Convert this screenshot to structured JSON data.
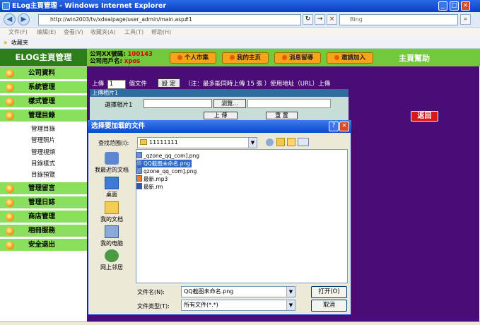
{
  "window": {
    "title": "ELog主頁管理 - Windows Internet Explorer"
  },
  "browser": {
    "url": "http://win2003/tv/xdealpage/user_admin/main.asp#1",
    "search_placeholder": "Bing",
    "menu": [
      "文件(F)",
      "编辑(E)",
      "查看(V)",
      "收藏夹(A)",
      "工具(T)",
      "帮助(H)"
    ],
    "favorites": "收藏夹"
  },
  "header": {
    "logo": "ELOG主頁管理",
    "account_label": "公司XX號碼:",
    "account_value": "100143",
    "user_label": "公司用戶名:",
    "user_value": "xpos",
    "buttons": [
      "个人市集",
      "我的主页",
      "消息留導",
      "邀請加入"
    ],
    "help": "主頁幫助"
  },
  "sidebar": {
    "items": [
      "公司資料",
      "系統管理",
      "樣式管理",
      "管理目錄",
      "管理留言",
      "管理日誌",
      "商店管理",
      "相冊服務",
      "安全退出"
    ],
    "subitems": [
      "管理目錄",
      "管理照片",
      "管理視頻",
      "目錄樣式",
      "目錄預覽"
    ]
  },
  "upload": {
    "prefix": "上傳",
    "count": "1",
    "unit": "個文件",
    "set_btn": "設 定",
    "note": "（注：最多能同時上傳 15 張 ）使用地址（URL）上傳",
    "section": "上傳相片1",
    "pick_label": "選擇相片1",
    "browse_btn": "瀏覽...",
    "upload_btn": "上 傳",
    "reset_btn": "重 置",
    "back_btn": "返回"
  },
  "dialog": {
    "title": "选择要加载的文件",
    "lookin_label": "查找范围(I):",
    "lookin_value": "11111111",
    "places": [
      "我最近的文档",
      "桌面",
      "我的文档",
      "我的电脑",
      "网上邻居"
    ],
    "files": [
      "_qzone_qq_com].png",
      "QQ截图未命名.png",
      "qzone_qq_com].png",
      "最新.mp3",
      "最新.rm"
    ],
    "selected_index": 1,
    "filename_label": "文件名(N):",
    "filename_value": "QQ截图未命名.png",
    "filetype_label": "文件类型(T):",
    "filetype_value": "所有文件(*.*)",
    "open_btn": "打开(O)",
    "cancel_btn": "取消"
  }
}
